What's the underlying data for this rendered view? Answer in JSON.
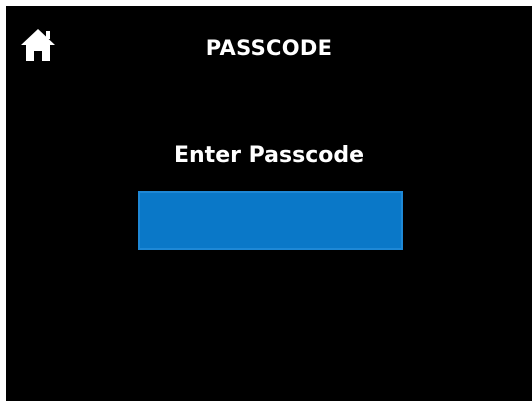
{
  "header": {
    "title": "PASSCODE",
    "home_icon": "home-icon"
  },
  "main": {
    "prompt": "Enter Passcode",
    "passcode_value": ""
  },
  "colors": {
    "background": "#000000",
    "text": "#ffffff",
    "input_fill": "#0a78c8",
    "input_border": "#1e88d6"
  }
}
